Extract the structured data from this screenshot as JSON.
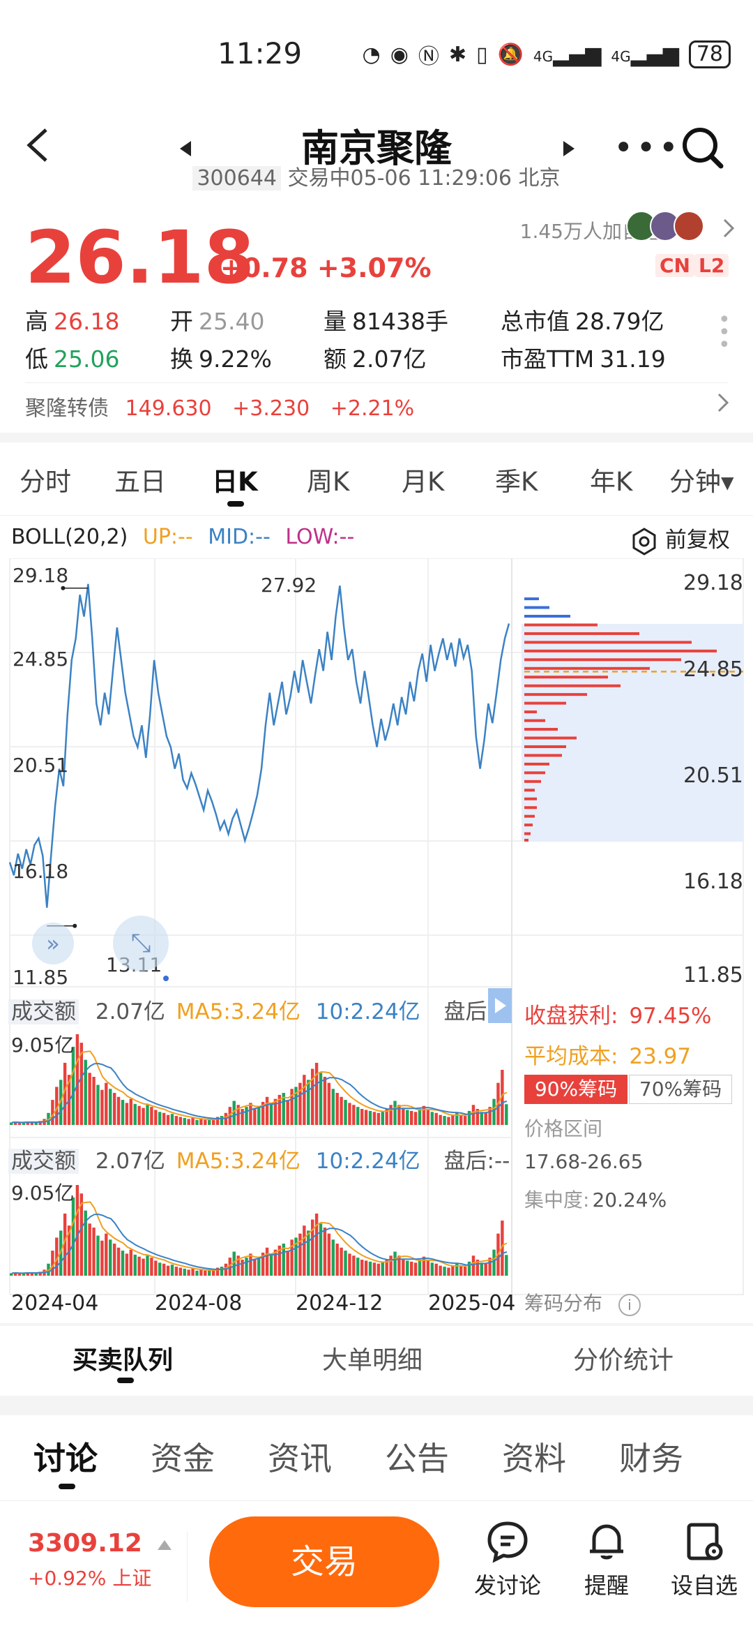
{
  "status_bar": {
    "time": "11:29",
    "signal_1": "4G",
    "signal_2": "4G",
    "battery": "78"
  },
  "header": {
    "title": "南京聚隆",
    "code": "300644",
    "status": "交易中05-06 11:29:06 北京"
  },
  "quote": {
    "price": "26.18",
    "change": "+0.78",
    "change_pct": "+3.07%",
    "watchers": "1.45万人加自选",
    "badge_cn": "CN",
    "badge_l2": "L2"
  },
  "stats": {
    "high_label": "高",
    "high": "26.18",
    "open_label": "开",
    "open": "25.40",
    "volume_label": "量",
    "volume": "81438手",
    "mktcap_label": "总市值",
    "mktcap": "28.79亿",
    "low_label": "低",
    "low": "25.06",
    "turnover_label": "换",
    "turnover": "9.22%",
    "amount_label": "额",
    "amount": "2.07亿",
    "pe_label": "市盈TTM",
    "pe": "31.19"
  },
  "convertible": {
    "name": "聚隆转债",
    "price": "149.630",
    "change": "+3.230",
    "pct": "+2.21%"
  },
  "period_tabs": [
    "分时",
    "五日",
    "日K",
    "周K",
    "月K",
    "季K",
    "年K",
    "分钟▾"
  ],
  "chart": {
    "boll_label": "BOLL(20,2)",
    "up_label": "UP:--",
    "mid_label": "MID:--",
    "low_label": "LOW:--",
    "adjust_label": "前复权",
    "y_left": [
      "29.18",
      "24.85",
      "20.51",
      "16.18",
      "11.85"
    ],
    "y_right": [
      "29.18",
      "24.85",
      "20.51",
      "16.18",
      "11.85"
    ],
    "max_annot": "27.92",
    "min_annot": "13.11",
    "ind1": {
      "name": "成交额",
      "val": "2.07亿",
      "ma5": "MA5:3.24亿",
      "ma10": "10:2.24亿",
      "after": "盘后:--",
      "ymax": "9.05亿"
    },
    "ind2": {
      "name": "成交额",
      "val": "2.07亿",
      "ma5": "MA5:3.24亿",
      "ma10": "10:2.24亿",
      "after": "盘后:--",
      "ymax": "9.05亿"
    },
    "x_labels": [
      "2024-04",
      "2024-08",
      "2024-12",
      "2025-04"
    ]
  },
  "chips": {
    "profit_label": "收盘获利:",
    "profit": "97.45%",
    "cost_label": "平均成本:",
    "cost": "23.97",
    "btn90": "90%筹码",
    "btn70": "70%筹码",
    "range_label": "价格区间",
    "range": "17.68-26.65",
    "concentration_label": "集中度:",
    "concentration": "20.24%",
    "dist_label": "筹码分布"
  },
  "sub_tabs": [
    "买卖队列",
    "大单明细",
    "分价统计"
  ],
  "main_tabs": [
    "讨论",
    "资金",
    "资讯",
    "公告",
    "资料",
    "财务"
  ],
  "footer": {
    "index_value": "3309.12",
    "index_change": "+0.92%",
    "index_name": "上证",
    "trade": "交易",
    "discuss": "发讨论",
    "remind": "提醒",
    "watch": "设自选"
  },
  "chart_data": {
    "type": "line",
    "title": "",
    "x_ticks": [
      "2024-04",
      "2024-08",
      "2024-12",
      "2025-04"
    ],
    "ylim": [
      11.85,
      29.18
    ],
    "series": [
      {
        "values": [
          15.2,
          14.6,
          15.6,
          14.9,
          15.8,
          15.1,
          16.0,
          16.3,
          15.5,
          13.11,
          15.5,
          17.8,
          19.5,
          18.7,
          22.0,
          24.5,
          25.5,
          27.5,
          26.5,
          28.0,
          25.5,
          22.5,
          21.5,
          23.0,
          22.0,
          24.0,
          26.0,
          24.5,
          23.0,
          22.0,
          21.0,
          20.5,
          21.5,
          20.0,
          22.0,
          24.5,
          23.0,
          22.0,
          21.0,
          20.5,
          19.5,
          20.2,
          19.0,
          18.6,
          19.3,
          18.8,
          18.2,
          17.6,
          18.5,
          18.0,
          17.4,
          16.7,
          17.1,
          16.5,
          17.2,
          17.6,
          16.9,
          16.2,
          16.8,
          17.5,
          18.3,
          19.5,
          21.5,
          23.0,
          21.5,
          22.5,
          23.5,
          22.0,
          22.8,
          24.0,
          23.0,
          24.5,
          23.5,
          22.5,
          23.8,
          25.0,
          24.0,
          25.8,
          24.5,
          26.5,
          27.92,
          26.0,
          24.5,
          25.0,
          23.5,
          22.5,
          24.0,
          22.8,
          21.5,
          20.5,
          21.8,
          20.8,
          21.5,
          22.5,
          21.5,
          22.8,
          22.0,
          23.5,
          22.6,
          24.0,
          24.8,
          23.5,
          25.2,
          24.0,
          24.8,
          25.5,
          24.5,
          25.3,
          24.2,
          25.5,
          24.6,
          25.2,
          24.0,
          21.0,
          19.5,
          20.8,
          22.5,
          21.6,
          23.0,
          24.5,
          25.5,
          26.18
        ]
      }
    ],
    "volume": {
      "ymax_label": "9.05亿",
      "values": [
        0.25,
        0.3,
        0.2,
        0.28,
        0.35,
        0.3,
        0.25,
        0.4,
        0.6,
        1.2,
        2.5,
        3.8,
        4.5,
        6.2,
        5.0,
        7.8,
        9.05,
        8.2,
        6.5,
        5.2,
        4.8,
        4.0,
        3.5,
        4.2,
        3.6,
        3.2,
        2.8,
        2.5,
        2.2,
        2.6,
        2.1,
        1.9,
        1.7,
        2.0,
        1.8,
        1.5,
        1.3,
        1.2,
        1.0,
        1.1,
        0.9,
        0.8,
        0.7,
        0.6,
        0.7,
        0.5,
        0.6,
        0.5,
        0.5,
        0.6,
        0.8,
        0.9,
        1.2,
        1.8,
        2.4,
        2.0,
        1.6,
        1.8,
        2.2,
        1.7,
        1.9,
        2.3,
        2.8,
        2.2,
        2.6,
        3.0,
        3.2,
        2.5,
        3.6,
        3.8,
        4.2,
        5.0,
        4.5,
        5.6,
        6.2,
        5.2,
        4.8,
        4.2,
        3.6,
        3.2,
        2.8,
        2.5,
        2.2,
        2.0,
        1.8,
        1.6,
        1.5,
        1.4,
        1.3,
        1.2,
        1.4,
        1.6,
        2.0,
        2.4,
        2.0,
        1.7,
        1.5,
        1.4,
        1.3,
        1.6,
        1.9,
        1.5,
        1.3,
        1.2,
        1.0,
        0.9,
        0.8,
        1.0,
        1.2,
        1.0,
        0.9,
        1.4,
        2.0,
        1.6,
        1.3,
        1.2,
        1.8,
        2.6,
        4.2,
        5.5,
        2.07
      ]
    },
    "chips_dist": {
      "ylim": [
        11.85,
        29.18
      ],
      "avg_cost": 23.97,
      "current": 26.18,
      "bins": [
        [
          16.2,
          0.02
        ],
        [
          16.5,
          0.03
        ],
        [
          16.9,
          0.04
        ],
        [
          17.3,
          0.05
        ],
        [
          17.7,
          0.06
        ],
        [
          18.1,
          0.06
        ],
        [
          18.5,
          0.05
        ],
        [
          18.9,
          0.08
        ],
        [
          19.3,
          0.1
        ],
        [
          19.7,
          0.12
        ],
        [
          20.1,
          0.18
        ],
        [
          20.5,
          0.2
        ],
        [
          20.9,
          0.25
        ],
        [
          21.3,
          0.16
        ],
        [
          21.7,
          0.1
        ],
        [
          22.1,
          0.06
        ],
        [
          22.5,
          0.2
        ],
        [
          22.9,
          0.3
        ],
        [
          23.3,
          0.46
        ],
        [
          23.7,
          0.4
        ],
        [
          24.1,
          0.6
        ],
        [
          24.5,
          0.75
        ],
        [
          24.9,
          0.92
        ],
        [
          25.3,
          0.8
        ],
        [
          25.7,
          0.55
        ],
        [
          26.1,
          0.35
        ],
        [
          26.5,
          0.22
        ],
        [
          26.9,
          0.12
        ],
        [
          27.3,
          0.07
        ]
      ]
    }
  }
}
